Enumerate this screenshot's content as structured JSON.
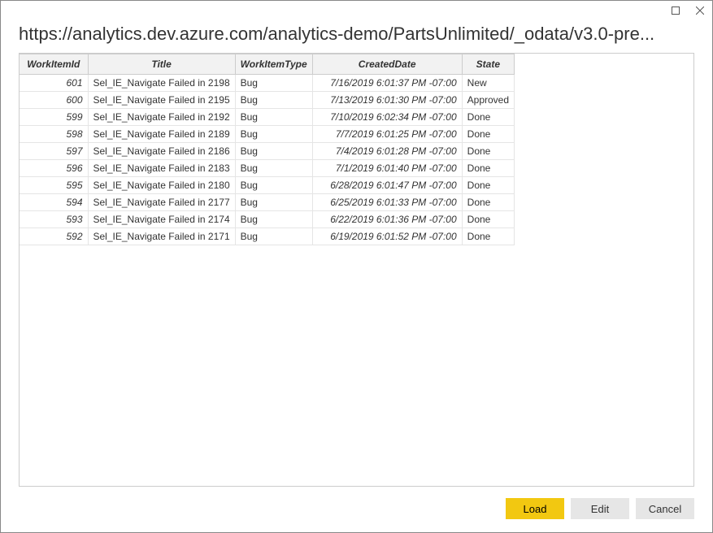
{
  "url": "https://analytics.dev.azure.com/analytics-demo/PartsUnlimited/_odata/v3.0-pre...",
  "columns": {
    "id": "WorkItemId",
    "title": "Title",
    "type": "WorkItemType",
    "date": "CreatedDate",
    "state": "State"
  },
  "rows": [
    {
      "id": "601",
      "title": "Sel_IE_Navigate Failed in 2198",
      "type": "Bug",
      "date": "7/16/2019 6:01:37 PM -07:00",
      "state": "New"
    },
    {
      "id": "600",
      "title": "Sel_IE_Navigate Failed in 2195",
      "type": "Bug",
      "date": "7/13/2019 6:01:30 PM -07:00",
      "state": "Approved"
    },
    {
      "id": "599",
      "title": "Sel_IE_Navigate Failed in 2192",
      "type": "Bug",
      "date": "7/10/2019 6:02:34 PM -07:00",
      "state": "Done"
    },
    {
      "id": "598",
      "title": "Sel_IE_Navigate Failed in 2189",
      "type": "Bug",
      "date": "7/7/2019 6:01:25 PM -07:00",
      "state": "Done"
    },
    {
      "id": "597",
      "title": "Sel_IE_Navigate Failed in 2186",
      "type": "Bug",
      "date": "7/4/2019 6:01:28 PM -07:00",
      "state": "Done"
    },
    {
      "id": "596",
      "title": "Sel_IE_Navigate Failed in 2183",
      "type": "Bug",
      "date": "7/1/2019 6:01:40 PM -07:00",
      "state": "Done"
    },
    {
      "id": "595",
      "title": "Sel_IE_Navigate Failed in 2180",
      "type": "Bug",
      "date": "6/28/2019 6:01:47 PM -07:00",
      "state": "Done"
    },
    {
      "id": "594",
      "title": "Sel_IE_Navigate Failed in 2177",
      "type": "Bug",
      "date": "6/25/2019 6:01:33 PM -07:00",
      "state": "Done"
    },
    {
      "id": "593",
      "title": "Sel_IE_Navigate Failed in 2174",
      "type": "Bug",
      "date": "6/22/2019 6:01:36 PM -07:00",
      "state": "Done"
    },
    {
      "id": "592",
      "title": "Sel_IE_Navigate Failed in 2171",
      "type": "Bug",
      "date": "6/19/2019 6:01:52 PM -07:00",
      "state": "Done"
    }
  ],
  "buttons": {
    "load": "Load",
    "edit": "Edit",
    "cancel": "Cancel"
  }
}
